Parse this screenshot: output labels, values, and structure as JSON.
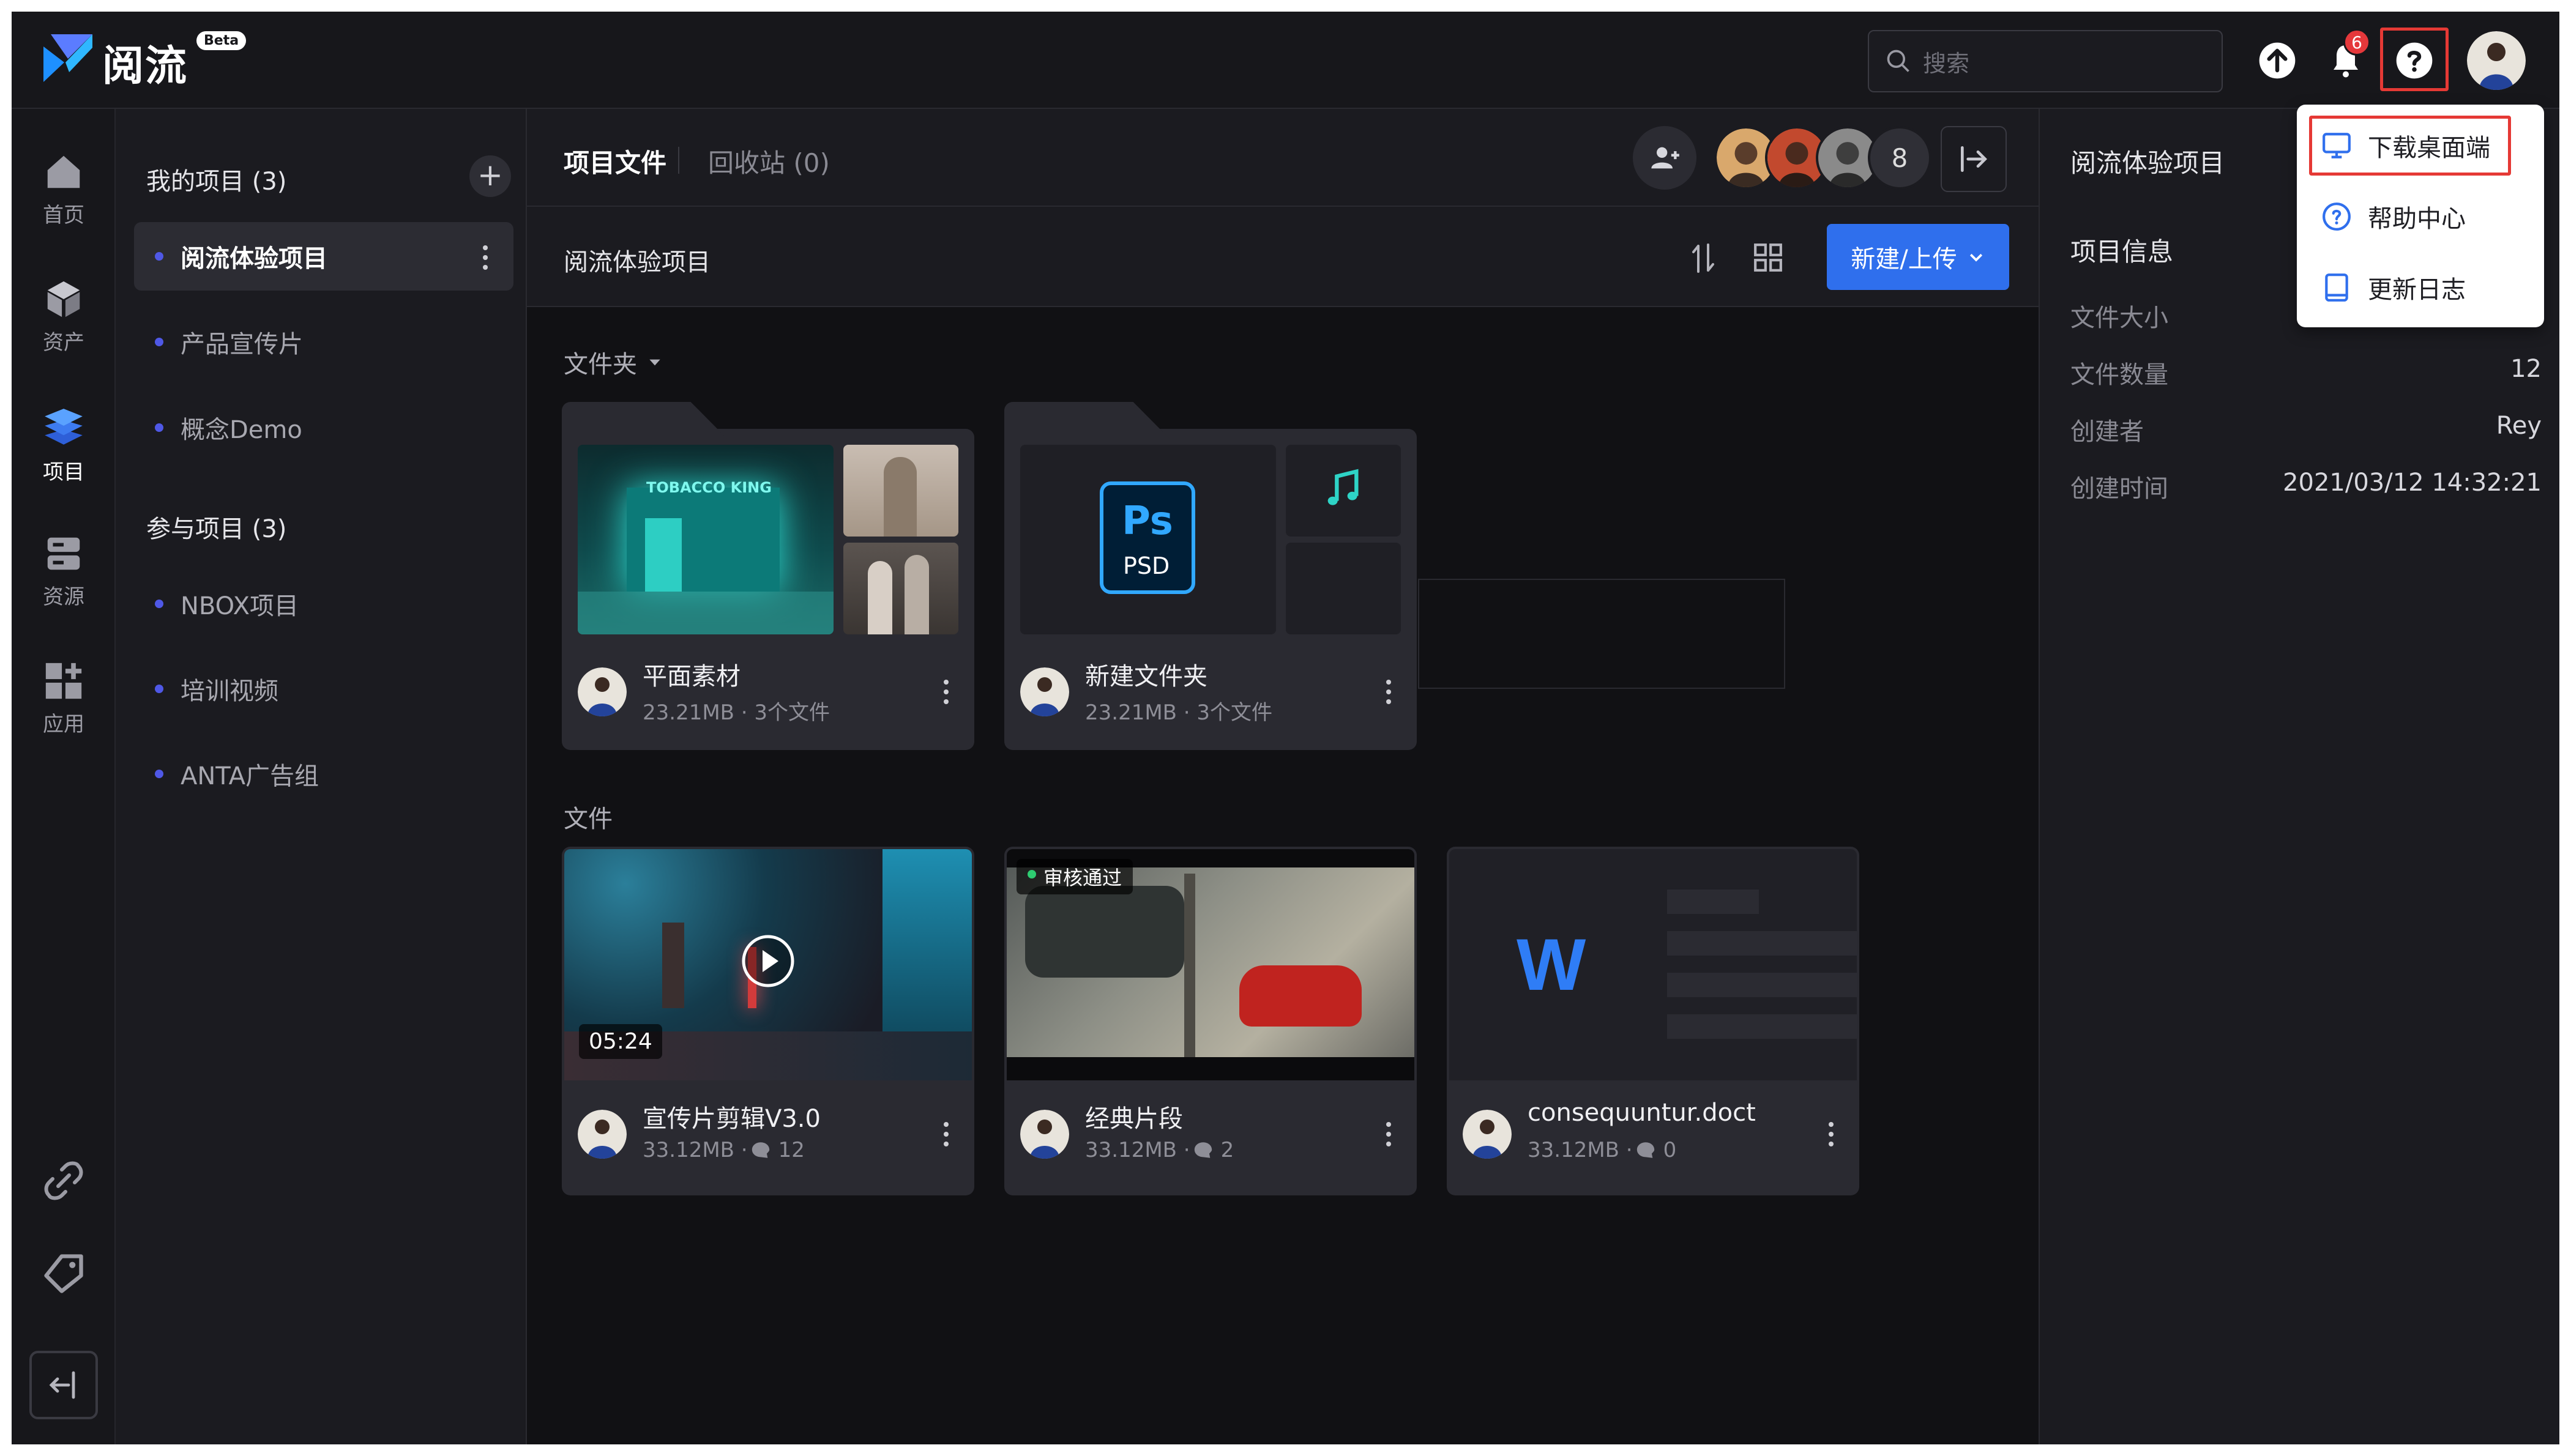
{
  "app": {
    "name": "阅流",
    "beta_label": "Beta"
  },
  "topbar": {
    "search_placeholder": "搜索",
    "notification_count": "6"
  },
  "rail": {
    "items": [
      {
        "label": "首页",
        "icon": "home-icon"
      },
      {
        "label": "资产",
        "icon": "assets-cube-icon"
      },
      {
        "label": "项目",
        "icon": "projects-layers-icon"
      },
      {
        "label": "资源",
        "icon": "resources-server-icon"
      },
      {
        "label": "应用",
        "icon": "apps-grid-icon"
      }
    ],
    "bottom_icons": [
      "link-icon",
      "tag-icon",
      "collapse-sidebar-icon"
    ]
  },
  "sidebar": {
    "my_projects_title": "我的项目 (3)",
    "my_projects": [
      {
        "name": "阅流体验项目",
        "active": true
      },
      {
        "name": "产品宣传片",
        "active": false
      },
      {
        "name": "概念Demo",
        "active": false
      }
    ],
    "joined_projects_title": "参与项目 (3)",
    "joined_projects": [
      {
        "name": "NBOX项目"
      },
      {
        "name": "培训视频"
      },
      {
        "name": "ANTA广告组"
      }
    ]
  },
  "main": {
    "tab_files": "项目文件",
    "tab_trash": "回收站 (0)",
    "member_extra_count": "8",
    "breadcrumb": "阅流体验项目",
    "new_upload_label": "新建/上传",
    "folders_label": "文件夹",
    "files_label": "文件",
    "folders": [
      {
        "title": "平面素材",
        "meta": "23.21MB · 3个文件",
        "thumb_text": "TOBACCO KING"
      },
      {
        "title": "新建文件夹",
        "meta": "23.21MB · 3个文件",
        "psd_ps": "Ps",
        "psd_label": "PSD"
      }
    ],
    "files": [
      {
        "title": "宣传片剪辑V3.0",
        "size": "33.12MB · ",
        "comments": "12",
        "duration": "05:24"
      },
      {
        "title": "经典片段",
        "size": "33.12MB · ",
        "comments": "2",
        "status": "审核通过"
      },
      {
        "title": "consequuntur.doct",
        "size": "33.12MB · ",
        "comments": "0",
        "doc_letter": "W"
      }
    ]
  },
  "right_panel": {
    "project_name": "阅流体验项目",
    "info_title": "项目信息",
    "rows": [
      {
        "key": "文件大小",
        "value": ""
      },
      {
        "key": "文件数量",
        "value": "12"
      },
      {
        "key": "创建者",
        "value": "Rey"
      },
      {
        "key": "创建时间",
        "value": "2021/03/12 14:32:21"
      }
    ]
  },
  "help_menu": {
    "items": [
      {
        "label": "下载桌面端",
        "icon": "monitor-icon"
      },
      {
        "label": "帮助中心",
        "icon": "question-circle-icon"
      },
      {
        "label": "更新日志",
        "icon": "book-icon"
      }
    ]
  },
  "colors": {
    "accent": "#2f6fed",
    "project_dot": "#4f58e6",
    "highlight": "#e53935",
    "music_icon": "#2ed3c6"
  }
}
